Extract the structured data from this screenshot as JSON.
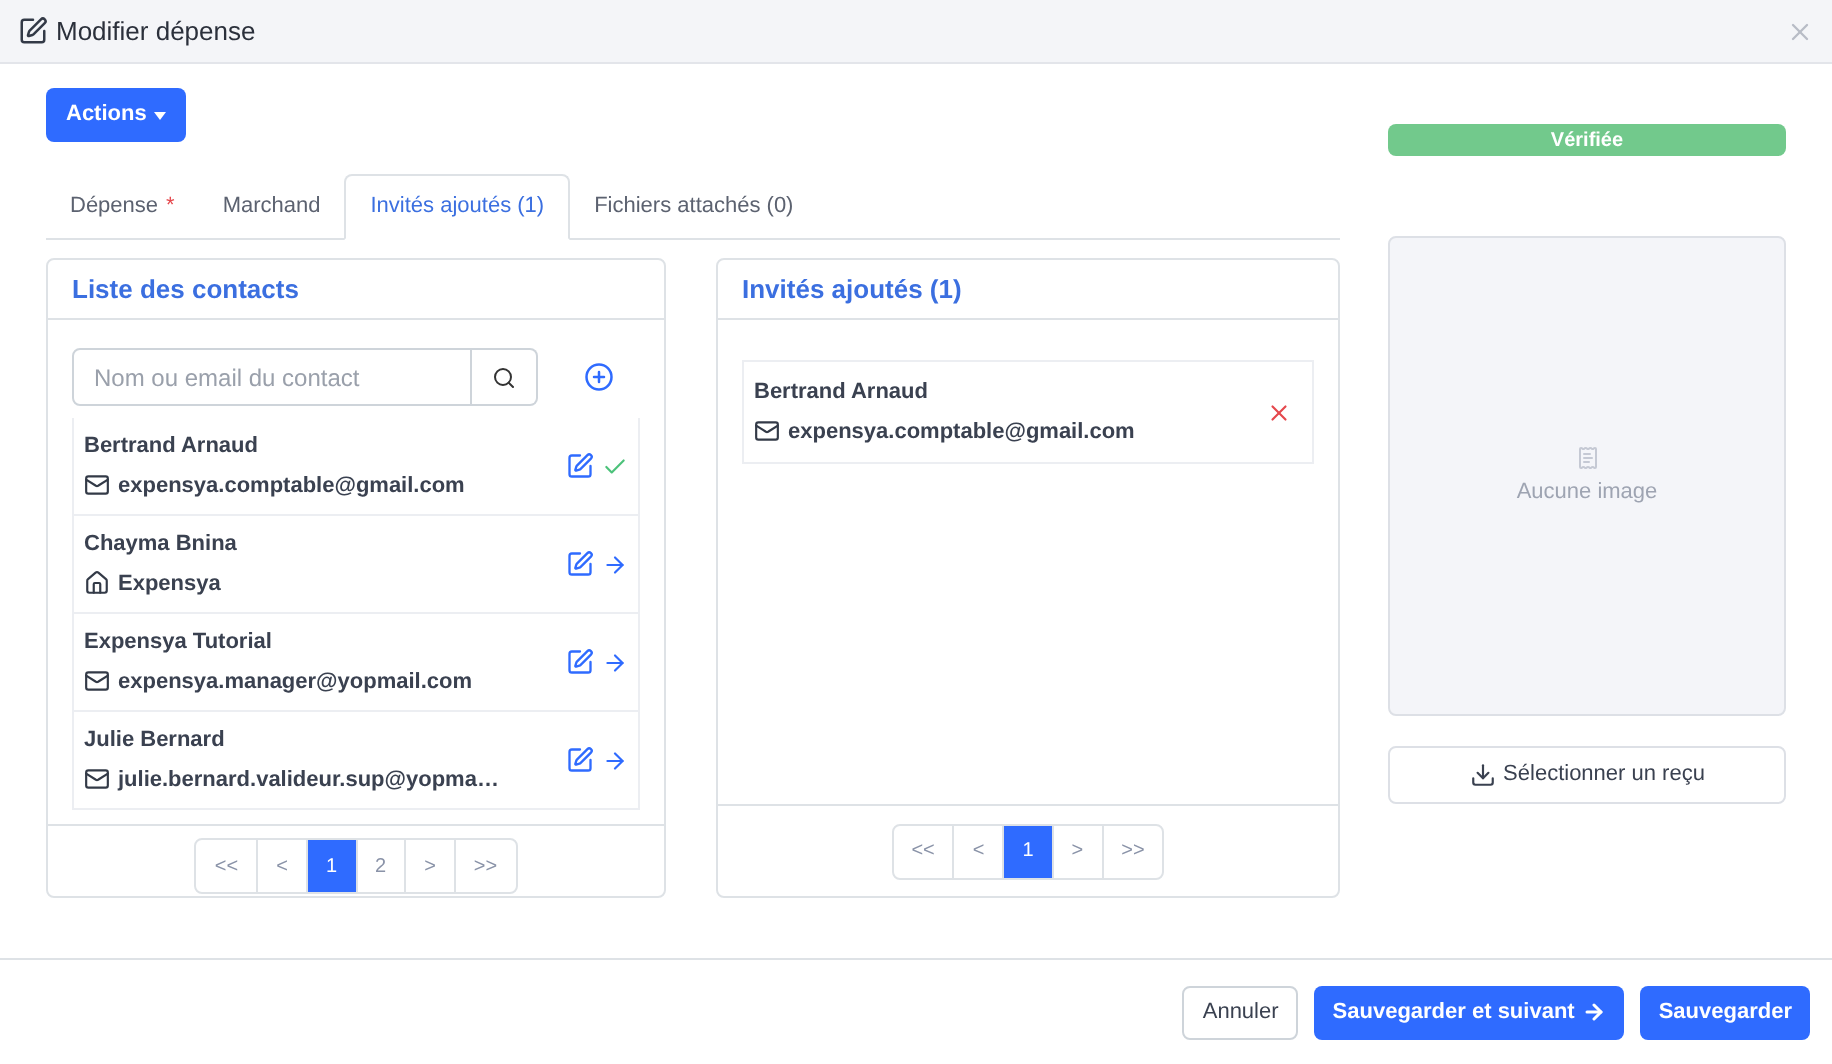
{
  "window": {
    "title": "Modifier dépense"
  },
  "actions_button": "Actions",
  "tabs": [
    {
      "label": "Dépense",
      "required_mark": "*",
      "selected": false
    },
    {
      "label": "Marchand",
      "selected": false
    },
    {
      "label": "Invités ajoutés (1)",
      "selected": true
    },
    {
      "label": "Fichiers attachés (0)",
      "selected": false
    }
  ],
  "contacts_panel": {
    "title": "Liste des contacts",
    "search": {
      "placeholder": "Nom ou email du contact"
    },
    "contacts": [
      {
        "name": "Bertrand Arnaud",
        "kind": "email",
        "detail": "expensya.comptable@gmail.com",
        "added": true
      },
      {
        "name": "Chayma Bnina",
        "kind": "company",
        "detail": "Expensya",
        "added": false
      },
      {
        "name": "Expensya Tutorial",
        "kind": "email",
        "detail": "expensya.manager@yopmail.com",
        "added": false
      },
      {
        "name": "Julie Bernard",
        "kind": "email",
        "detail": "julie.bernard.valideur.sup@yopma…",
        "added": false
      }
    ],
    "pagination": [
      {
        "label": "<<",
        "selected": false
      },
      {
        "label": "<",
        "selected": false
      },
      {
        "label": "1",
        "selected": true
      },
      {
        "label": "2",
        "selected": false
      },
      {
        "label": ">",
        "selected": false
      },
      {
        "label": ">>",
        "selected": false
      }
    ]
  },
  "guests_panel": {
    "title": "Invités ajoutés (1)",
    "guests": [
      {
        "name": "Bertrand Arnaud",
        "kind": "email",
        "detail": "expensya.comptable@gmail.com"
      }
    ],
    "pagination": [
      {
        "label": "<<",
        "selected": false
      },
      {
        "label": "<",
        "selected": false
      },
      {
        "label": "1",
        "selected": true
      },
      {
        "label": ">",
        "selected": false
      },
      {
        "label": ">>",
        "selected": false
      }
    ]
  },
  "status_badge": "Vérifiée",
  "receipt": {
    "empty_text": "Aucune image",
    "select_button": "Sélectionner un reçu"
  },
  "footer_buttons": [
    {
      "label": "Annuler",
      "kind": "secondary"
    },
    {
      "label": "Sauvegarder et suivant",
      "kind": "next"
    },
    {
      "label": "Sauvegarder",
      "kind": "primary"
    }
  ]
}
